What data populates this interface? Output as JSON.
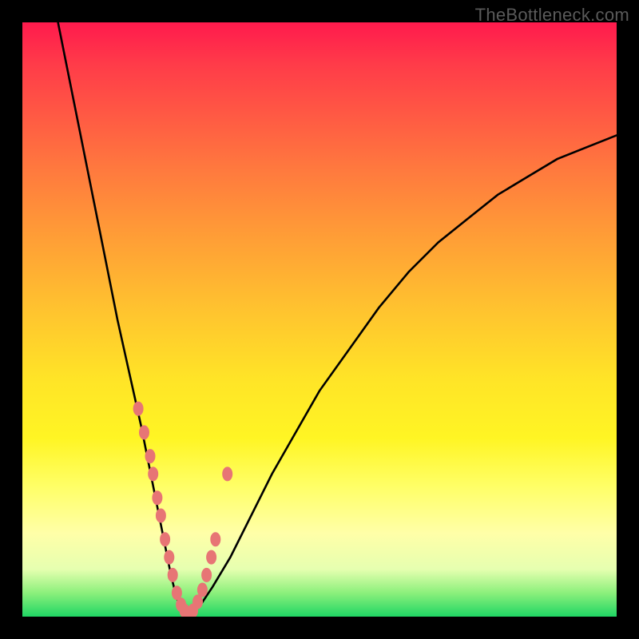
{
  "watermark": "TheBottleneck.com",
  "chart_data": {
    "type": "line",
    "title": "",
    "xlabel": "",
    "ylabel": "",
    "xlim": [
      0,
      100
    ],
    "ylim": [
      0,
      100
    ],
    "series": [
      {
        "name": "bottleneck-curve",
        "x": [
          6,
          8,
          10,
          12,
          14,
          16,
          18,
          20,
          22,
          24,
          25,
          26,
          27,
          28,
          30,
          32,
          35,
          38,
          42,
          46,
          50,
          55,
          60,
          65,
          70,
          75,
          80,
          85,
          90,
          95,
          100
        ],
        "values": [
          100,
          90,
          80,
          70,
          60,
          50,
          41,
          32,
          22,
          12,
          7,
          3,
          1,
          0.5,
          2,
          5,
          10,
          16,
          24,
          31,
          38,
          45,
          52,
          58,
          63,
          67,
          71,
          74,
          77,
          79,
          81
        ]
      }
    ],
    "markers": {
      "name": "highlight-points",
      "x": [
        19.5,
        20.5,
        21.5,
        22.0,
        22.7,
        23.3,
        24.0,
        24.7,
        25.3,
        26.0,
        26.7,
        27.3,
        28.0,
        28.7,
        29.5,
        30.3,
        31.0,
        31.8,
        32.5,
        34.5
      ],
      "values": [
        35,
        31,
        27,
        24,
        20,
        17,
        13,
        10,
        7,
        4,
        2,
        1,
        0.5,
        1,
        2.5,
        4.5,
        7,
        10,
        13,
        24
      ]
    }
  }
}
